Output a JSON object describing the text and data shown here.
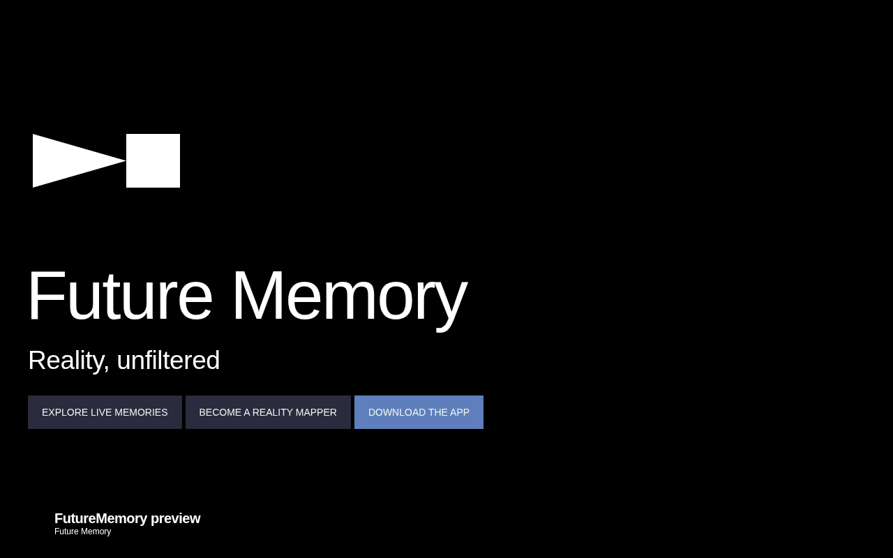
{
  "hero": {
    "title": "Future Memory",
    "tagline": "Reality, unfiltered",
    "buttons": [
      {
        "label": "EXPLORE LIVE MEMORIES",
        "kind": "secondary"
      },
      {
        "label": "BECOME A REALITY MAPPER",
        "kind": "secondary"
      },
      {
        "label": "DOWNLOAD THE APP",
        "kind": "primary"
      }
    ]
  },
  "footer": {
    "title": "FutureMemory preview",
    "subtitle": "Future Memory"
  }
}
